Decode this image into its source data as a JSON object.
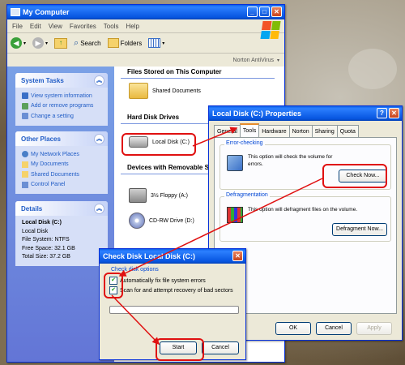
{
  "my_computer": {
    "title": "My Computer",
    "menu": [
      "File",
      "Edit",
      "View",
      "Favorites",
      "Tools",
      "Help"
    ],
    "toolbar": {
      "search": "Search",
      "folders": "Folders"
    },
    "address_right": "Norton AntiVirus",
    "system_tasks": {
      "title": "System Tasks",
      "items": [
        "View system information",
        "Add or remove programs",
        "Change a setting"
      ]
    },
    "other_places": {
      "title": "Other Places",
      "items": [
        "My Network Places",
        "My Documents",
        "Shared Documents",
        "Control Panel"
      ]
    },
    "details": {
      "title": "Details",
      "name": "Local Disk (C:)",
      "type": "Local Disk",
      "fs": "File System: NTFS",
      "free": "Free Space: 32.1 GB",
      "total": "Total Size: 37.2 GB"
    },
    "sections": {
      "files": "Files Stored on This Computer",
      "hdd": "Hard Disk Drives",
      "removable": "Devices with Removable Stor"
    },
    "items": {
      "shared": "Shared Documents",
      "local_disk": "Local Disk (C:)",
      "floppy": "3½ Floppy (A:)",
      "cdrw": "CD-RW Drive (D:)"
    }
  },
  "properties": {
    "title": "Local Disk (C:) Properties",
    "tabs": [
      "General",
      "Tools",
      "Hardware",
      "Norton",
      "Sharing",
      "Quota"
    ],
    "error_checking": {
      "label": "Error-checking",
      "text": "This option will check the volume for errors.",
      "button": "Check Now..."
    },
    "defrag": {
      "label": "Defragmentation",
      "text": "This option will defragment files on the volume.",
      "button": "Defragment Now..."
    },
    "buttons": {
      "ok": "OK",
      "cancel": "Cancel",
      "apply": "Apply"
    }
  },
  "check_disk": {
    "title": "Check Disk Local Disk (C:)",
    "options_label": "Check disk options",
    "option1": "Automatically fix file system errors",
    "option2": "Scan for and attempt recovery of bad sectors",
    "option1_checked": true,
    "option2_checked": true,
    "start": "Start",
    "cancel": "Cancel"
  },
  "colors": {
    "highlight": "#e01010",
    "title_blue": "#0755e0",
    "link": "#215dc6"
  }
}
